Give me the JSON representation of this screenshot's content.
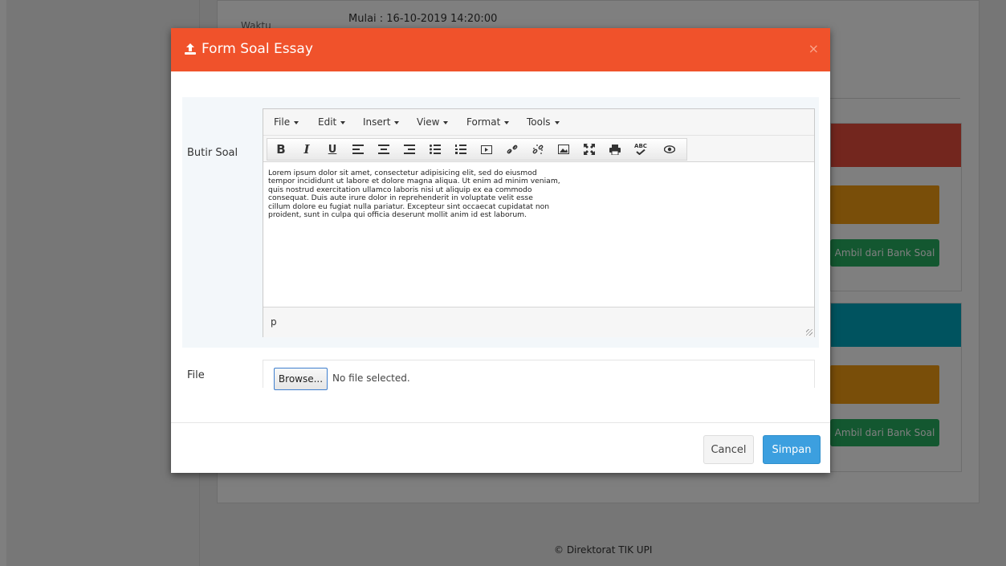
{
  "background": {
    "waktu_label": "Waktu",
    "mulai_text": "Mulai : 16-10-2019 14:20:00",
    "bank_soal_button_1": "Ambil dari Bank Soal",
    "bank_soal_button_2": "Ambil dari Bank Soal",
    "footer": "© Direktorat TIK UPI"
  },
  "modal": {
    "title": "Form Soal Essay",
    "title_icon": "upload-icon",
    "close_glyph": "×",
    "butir_soal_label": "Butir Soal",
    "file_label": "File",
    "editor": {
      "menus": [
        "File",
        "Edit",
        "Insert",
        "View",
        "Format",
        "Tools"
      ],
      "toolbar_icons": [
        "bold-icon",
        "italic-icon",
        "underline-icon",
        "align-left-icon",
        "align-center-icon",
        "align-right-icon",
        "bullet-list-icon",
        "numbered-list-icon",
        "media-icon",
        "link-icon",
        "unlink-icon",
        "image-icon",
        "fullscreen-icon",
        "print-icon",
        "spellcheck-icon",
        "preview-icon"
      ],
      "content": "Lorem ipsum dolor sit amet, consectetur adipisicing elit, sed do eiusmod\ntempor incididunt ut labore et dolore magna aliqua. Ut enim ad minim veniam,\nquis nostrud exercitation ullamco laboris nisi ut aliquip ex ea commodo\nconsequat. Duis aute irure dolor in reprehenderit in voluptate velit esse\ncillum dolore eu fugiat nulla pariatur. Excepteur sint occaecat cupidatat non\nproident, sunt in culpa qui officia deserunt mollit anim id est laborum.",
      "status_path": "p"
    },
    "file_input": {
      "button": "Browse...",
      "status": "No file selected."
    },
    "buttons": {
      "cancel": "Cancel",
      "save": "Simpan"
    }
  },
  "colors": {
    "header": "#f0522b",
    "primary": "#3c9fdf",
    "red_panel": "#e74c3c",
    "teal_panel": "#00a7bf",
    "warning": "#f39c12",
    "success": "#27ae60"
  }
}
